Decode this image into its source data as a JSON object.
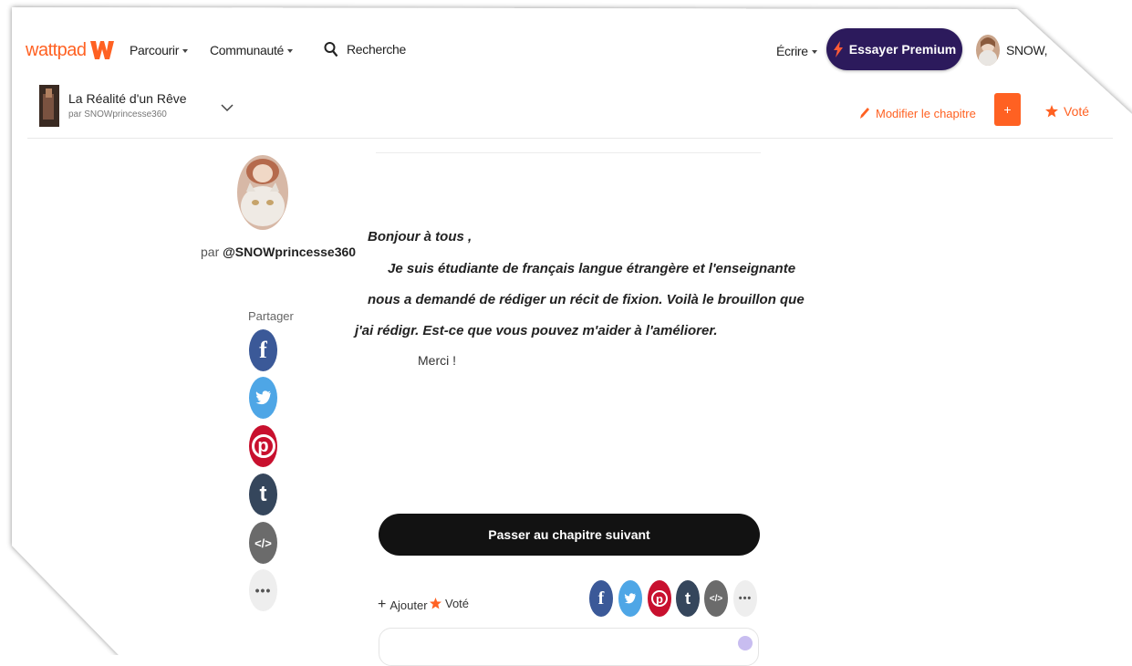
{
  "header": {
    "logo_text": "wattpad",
    "nav_browse": "Parcourir",
    "nav_community": "Communauté",
    "search_placeholder": "Recherche",
    "write_label": "Écrire",
    "premium_label": "Essayer Premium",
    "username": "SNOW,"
  },
  "story_bar": {
    "title": "La Réalité d'un Rêve",
    "author_line": "par SNOWprincesse360",
    "modify_label": "Modifier le chapitre",
    "add_label": "+",
    "vote_label": "Voté"
  },
  "sidebar": {
    "by_prefix": "par",
    "author_handle": "@SNOWprincesse360",
    "share_label": "Partager",
    "share_icons": [
      "facebook-icon",
      "twitter-icon",
      "pinterest-icon",
      "tumblr-icon",
      "embed-icon",
      "more-icon"
    ]
  },
  "content": {
    "line1": "Bonjour à tous ,",
    "line2": "Je suis étudiante de français langue étrangère et l'enseignante",
    "line3": "nous a demandé de rédiger un récit de fixion.  Voilà le brouillon que",
    "line4": "j'ai rédigr. Est-ce que vous pouvez m'aider à l'améliorer.",
    "line5": "Merci !"
  },
  "footer": {
    "next_chapter_label": "Passer au chapitre suivant",
    "add_label": "Ajouter",
    "vote_label": "Voté"
  },
  "colors": {
    "brand_orange": "#ff6122",
    "premium_purple": "#2c1a5c",
    "facebook": "#3b5998",
    "twitter": "#4ea6e6",
    "pinterest": "#c8102e",
    "tumblr": "#35465c",
    "embed": "#6b6b6b"
  }
}
